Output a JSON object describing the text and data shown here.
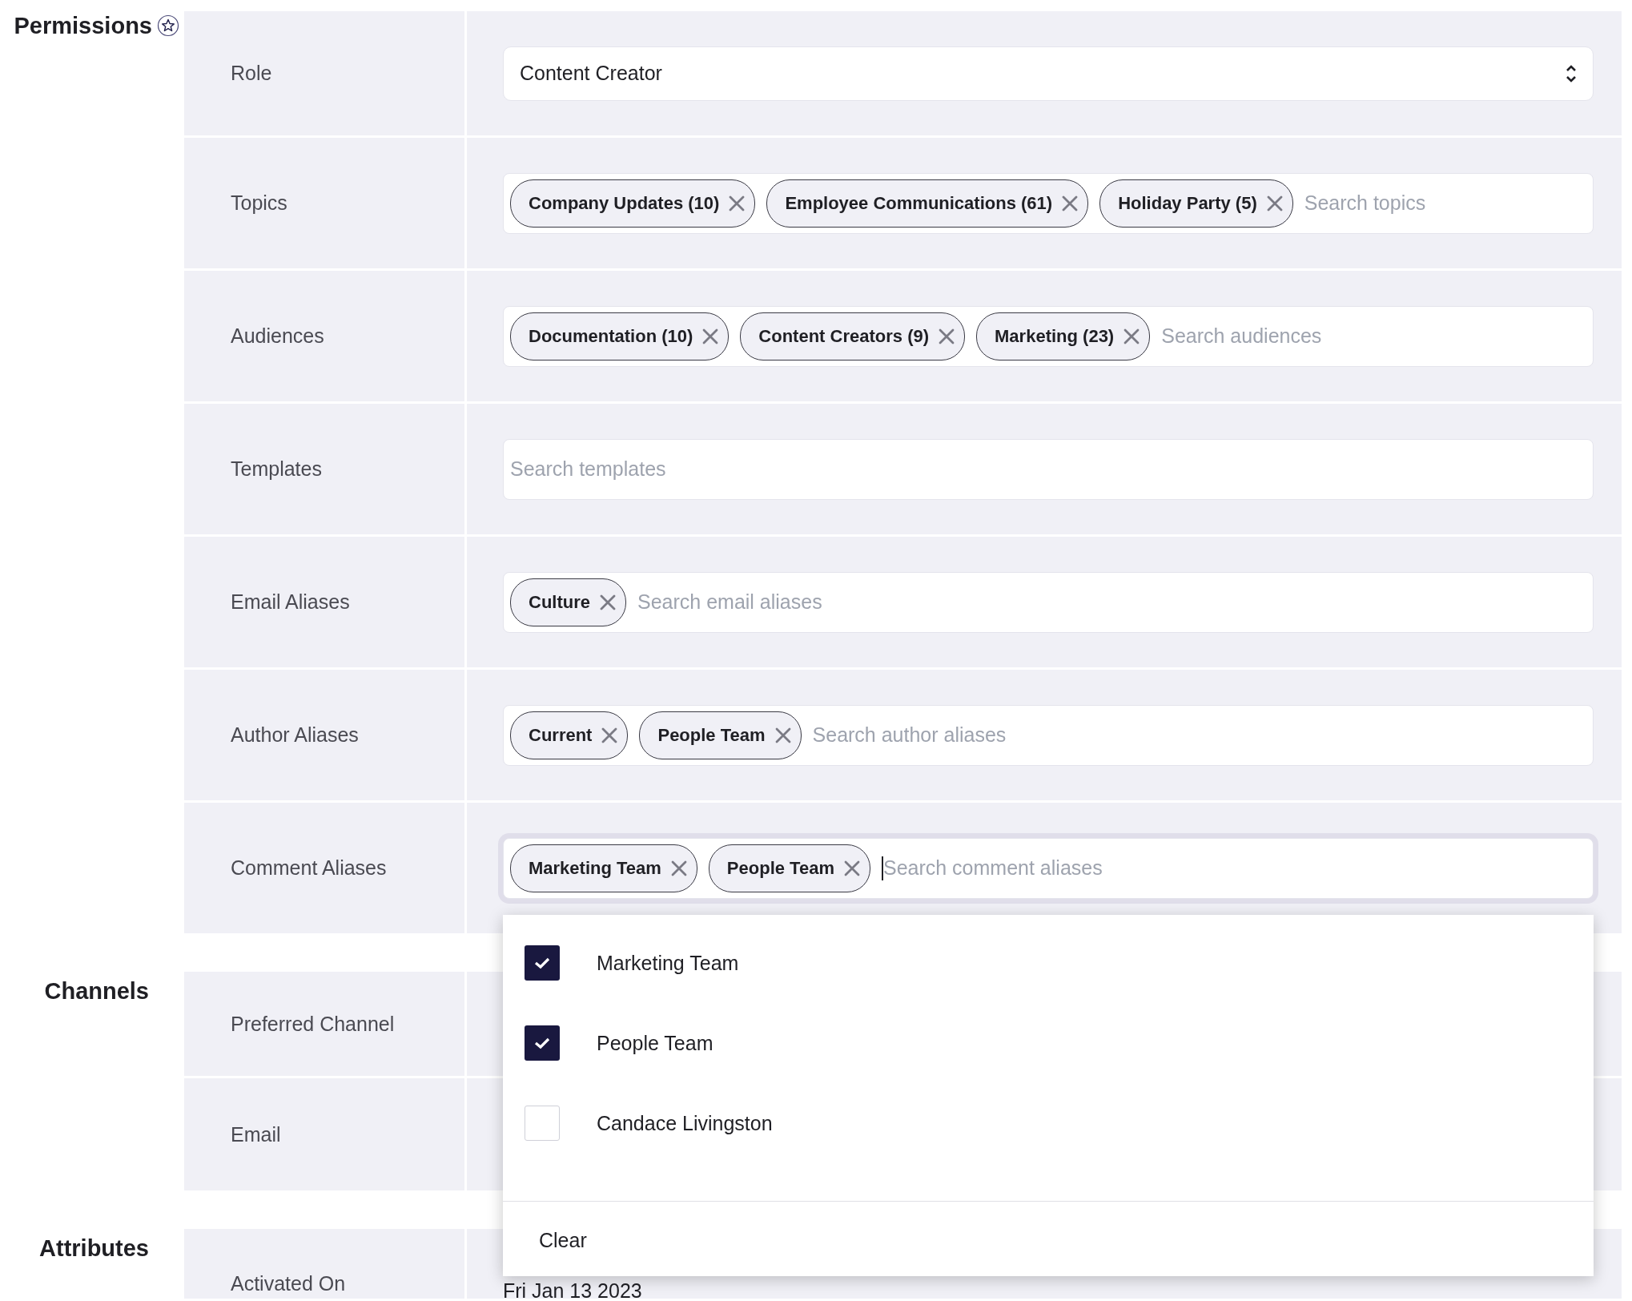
{
  "sections": [
    {
      "title": "Permissions",
      "starred": true,
      "rows": [
        {
          "label": "Role",
          "kind": "select",
          "value": "Content Creator"
        },
        {
          "label": "Topics",
          "kind": "tags",
          "tags": [
            "Company Updates (10)",
            "Employee Communications (61)",
            "Holiday Party (5)"
          ],
          "placeholder": "Search topics",
          "focused": false
        },
        {
          "label": "Audiences",
          "kind": "tags",
          "tags": [
            "Documentation (10)",
            "Content Creators (9)",
            "Marketing (23)"
          ],
          "placeholder": "Search audiences",
          "focused": false
        },
        {
          "label": "Templates",
          "kind": "tags",
          "tags": [],
          "placeholder": "Search templates",
          "focused": false
        },
        {
          "label": "Email Aliases",
          "kind": "tags",
          "tags": [
            "Culture"
          ],
          "placeholder": "Search email aliases",
          "focused": false
        },
        {
          "label": "Author Aliases",
          "kind": "tags",
          "tags": [
            "Current",
            "People Team"
          ],
          "placeholder": "Search author aliases",
          "focused": false
        },
        {
          "label": "Comment Aliases",
          "kind": "tags",
          "tags": [
            "Marketing Team",
            "People Team"
          ],
          "placeholder": "Search comment aliases",
          "focused": true,
          "menu": {
            "options": [
              {
                "label": "Marketing Team",
                "checked": true
              },
              {
                "label": "People Team",
                "checked": true
              },
              {
                "label": "Candace Livingston",
                "checked": false
              }
            ],
            "clear": "Clear"
          }
        }
      ]
    },
    {
      "title": "Channels",
      "starred": false,
      "rows": [
        {
          "label": "Preferred Channel",
          "kind": "hidden"
        },
        {
          "label": "Email",
          "kind": "hidden"
        }
      ]
    },
    {
      "title": "Attributes",
      "starred": false,
      "rows": [
        {
          "label": "Activated On",
          "kind": "text",
          "value": "Fri Jan 13 2023"
        }
      ]
    }
  ]
}
